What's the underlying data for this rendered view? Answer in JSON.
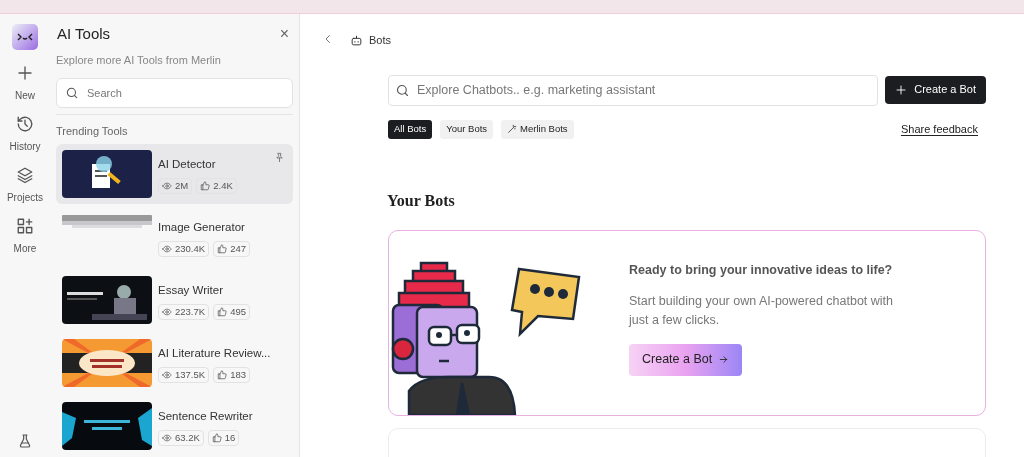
{
  "rail": {
    "items": [
      {
        "label": "New",
        "kind": "new"
      },
      {
        "label": "History",
        "kind": "history"
      },
      {
        "label": "Projects",
        "kind": "projects"
      },
      {
        "label": "More",
        "kind": "more"
      }
    ]
  },
  "panel": {
    "title": "AI Tools",
    "close": "×",
    "subtitle": "Explore more AI Tools from Merlin",
    "search": {
      "placeholder": "Search"
    },
    "section": "Trending Tools",
    "tools": [
      {
        "name": "AI Detector",
        "views": "2M",
        "likes": "2.4K",
        "selected": true,
        "pinned": true
      },
      {
        "name": "Image Generator",
        "views": "230.4K",
        "likes": "247",
        "selected": false,
        "pinned": false
      },
      {
        "name": "Essay Writer",
        "views": "223.7K",
        "likes": "495",
        "selected": false,
        "pinned": false
      },
      {
        "name": "AI Literature Review...",
        "views": "137.5K",
        "likes": "183",
        "selected": false,
        "pinned": false
      },
      {
        "name": "Sentence Rewriter",
        "views": "63.2K",
        "likes": "16",
        "selected": false,
        "pinned": false
      }
    ]
  },
  "main": {
    "breadcrumb": "Bots",
    "search": {
      "placeholder": "Explore Chatbots.. e.g. marketing assistant"
    },
    "create_button": "Create a Bot",
    "filters": [
      {
        "label": "All Bots",
        "selected": true,
        "kind": "plain"
      },
      {
        "label": "Your Bots",
        "selected": false,
        "kind": "plain"
      },
      {
        "label": "Merlin Bots",
        "selected": false,
        "kind": "wand"
      }
    ],
    "feedback": "Share feedback",
    "heading": "Your Bots",
    "card": {
      "title": "Ready to bring your innovative ideas to life?",
      "text": "Start building your own AI-powered chatbot with just a few clicks.",
      "button": "Create a Bot"
    }
  }
}
